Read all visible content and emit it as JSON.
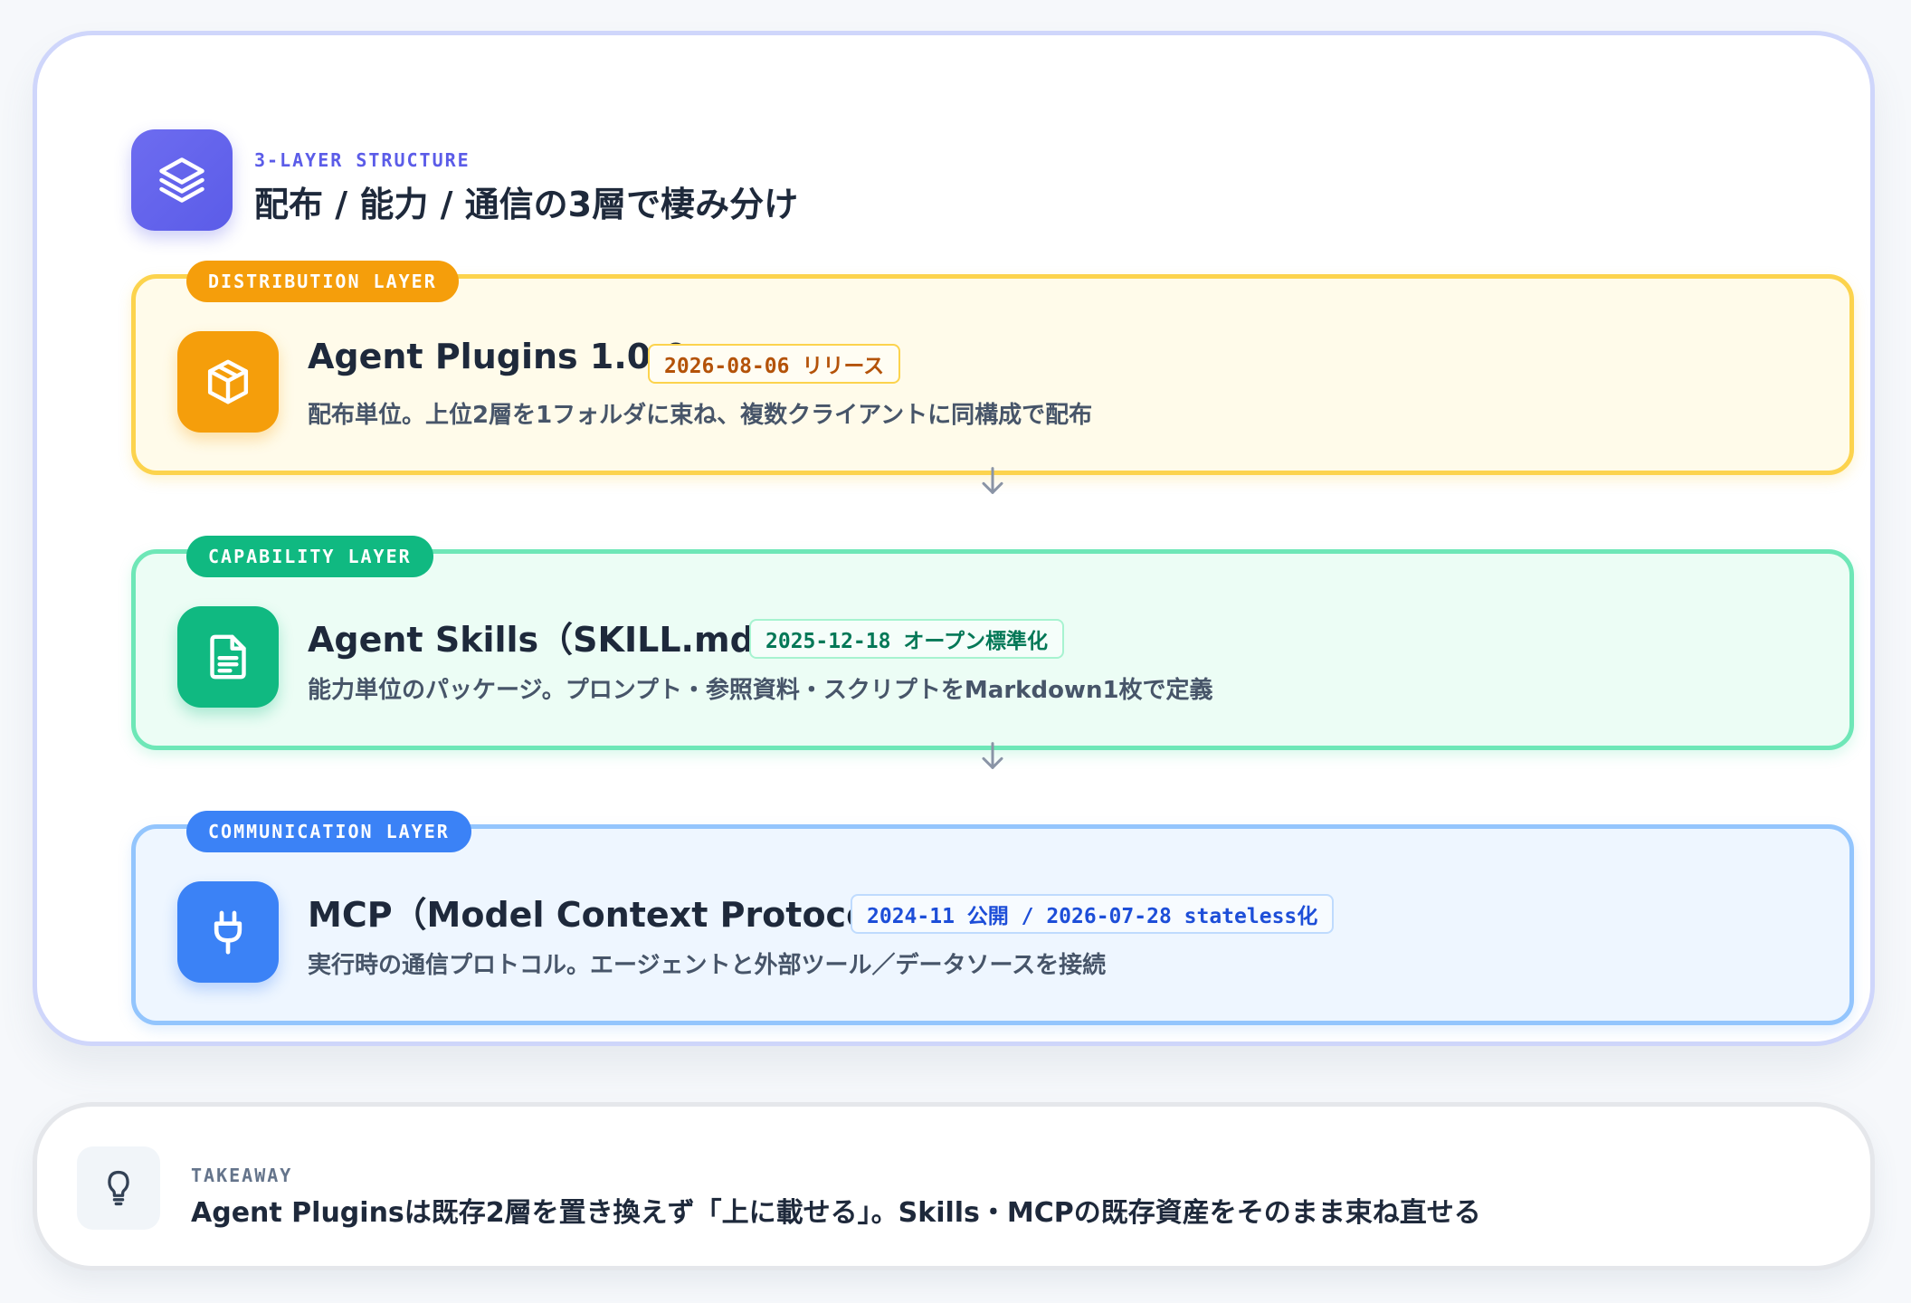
{
  "header": {
    "eyebrow": "3-LAYER STRUCTURE",
    "title": "配布 / 能力 / 通信の3層で棲み分け",
    "icon": "layers-icon"
  },
  "layers": [
    {
      "tag": "DISTRIBUTION LAYER",
      "title": "Agent Plugins 1.0.0",
      "badge": "2026-08-06 リリース",
      "description": "配布単位。上位2層を1フォルダに束ね、複数クライアントに同構成で配布",
      "icon": "package-icon",
      "color": "#f59e0b"
    },
    {
      "tag": "CAPABILITY LAYER",
      "title": "Agent Skills（SKILL.md）",
      "badge": "2025-12-18 オープン標準化",
      "description": "能力単位のパッケージ。プロンプト・参照資料・スクリプトをMarkdown1枚で定義",
      "icon": "document-icon",
      "color": "#10b981"
    },
    {
      "tag": "COMMUNICATION LAYER",
      "title": "MCP（Model Context Protocol）",
      "badge": "2024-11 公開 / 2026-07-28 stateless化",
      "description": "実行時の通信プロトコル。エージェントと外部ツール／データソースを接続",
      "icon": "plug-icon",
      "color": "#3b82f6"
    }
  ],
  "takeaway": {
    "label": "TAKEAWAY",
    "text": "Agent Pluginsは既存2層を置き換えず「上に載せる」。Skills・MCPの既存資産をそのまま束ね直せる",
    "icon": "lightbulb-icon"
  },
  "colors": {
    "accent": "#5b5ce8",
    "distribution": "#f59e0b",
    "capability": "#10b981",
    "communication": "#3b82f6"
  }
}
